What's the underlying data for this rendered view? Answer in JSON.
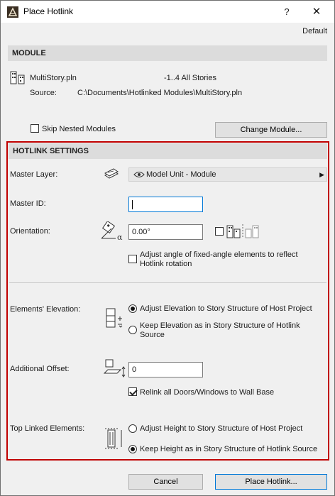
{
  "window": {
    "title": "Place Hotlink",
    "help_label": "?",
    "close_label": "✕",
    "default_label": "Default"
  },
  "module": {
    "header": "MODULE",
    "file_name": "MultiStory.pln",
    "stories": "-1..4 All Stories",
    "source_label": "Source:",
    "source_path": "C:\\Documents\\Hotlinked Modules\\MultiStory.pln",
    "skip_nested_label": "Skip Nested Modules",
    "skip_nested_checked": false,
    "change_module_label": "Change Module..."
  },
  "hotlink_settings": {
    "header": "HOTLINK SETTINGS",
    "master_layer_label": "Master Layer:",
    "master_layer_value": "Model Unit - Module",
    "master_id_label": "Master ID:",
    "master_id_value": "",
    "orientation_label": "Orientation:",
    "orientation_value": "0.00°",
    "mirror_checked": false,
    "adjust_angle_label_1": "Adjust angle of fixed-angle elements to reflect",
    "adjust_angle_label_2": "Hotlink rotation",
    "adjust_angle_checked": false,
    "elevation_label": "Elements' Elevation:",
    "elevation_option_1": "Adjust Elevation to Story Structure of Host Project",
    "elevation_option_2a": "Keep Elevation as in Story Structure of Hotlink",
    "elevation_option_2b": "Source",
    "elevation_selected": 1,
    "offset_label": "Additional Offset:",
    "offset_value": "0",
    "relink_label": "Relink all Doors/Windows to Wall Base",
    "relink_checked": true,
    "top_linked_label": "Top Linked Elements:",
    "top_option_1": "Adjust Height to Story Structure of Host Project",
    "top_option_2": "Keep Height as in Story Structure of Hotlink Source",
    "top_selected": 2
  },
  "footer": {
    "cancel_label": "Cancel",
    "place_label": "Place Hotlink..."
  },
  "colors": {
    "highlight_frame": "#c00000",
    "focus_border": "#0078d7"
  }
}
